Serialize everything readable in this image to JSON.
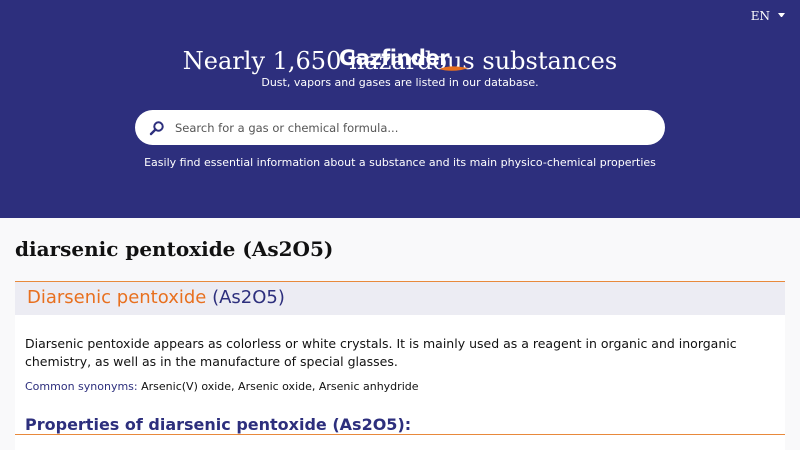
{
  "header": {
    "language": "EN",
    "logo_text": "Gazfinder",
    "title": "Nearly 1,650 hazardous substances",
    "subtitle": "Dust, vapors and gases are listed in our database.",
    "search_placeholder": "Search for a gas or chemical formula...",
    "tagline": "Easily find essential information about a substance and its main physico-chemical properties"
  },
  "page": {
    "title": "diarsenic pentoxide (As2O5)"
  },
  "card": {
    "name": "Diarsenic pentoxide",
    "formula": "(As2O5)",
    "description": "Diarsenic pentoxide appears as colorless or white crystals.  It is mainly used as a reagent in organic and inorganic chemistry, as well as in the manufacture of special glasses.",
    "synonyms_label": "Common synonyms:",
    "synonyms_value": "Arsenic(V) oxide, Arsenic oxide, Arsenic anhydride",
    "properties_title": "Properties of diarsenic pentoxide (As2O5):"
  },
  "colors": {
    "header_bg": "#2d2f7d",
    "accent_orange": "#e8701f",
    "navy": "#2d2f7d"
  },
  "icons": {
    "search": "search-icon",
    "caret": "caret-down-icon",
    "logo_flame": "flame-icon"
  }
}
